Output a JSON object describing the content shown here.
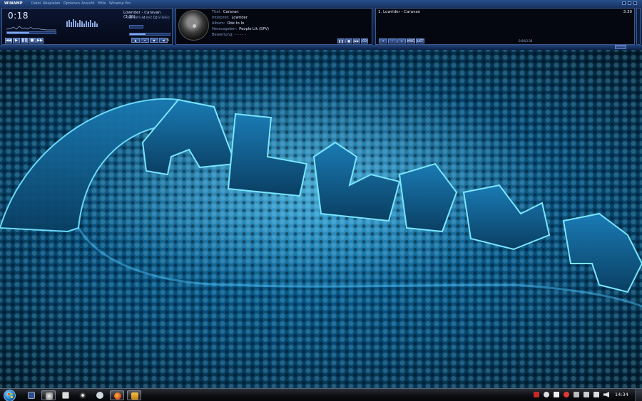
{
  "menubar": {
    "brand": "WINAMP",
    "items": [
      "Datei",
      "Abspielen",
      "Optionen",
      "Ansicht",
      "Hilfe",
      "Winamp Pro"
    ]
  },
  "player": {
    "time": "0:18",
    "track_title": "Lowrider - Caravan (3:30)",
    "bitrate_value": "192",
    "bitrate_unit": "KBPS",
    "samplerate_value": "44",
    "samplerate_unit": "KHZ",
    "mode_value": "CD",
    "mode_unit": "STEREO",
    "volume_fraction": 0.45,
    "transport_buttons": [
      "◀◀",
      "▶",
      "❚❚",
      "■",
      "▶▶"
    ],
    "right_buttons": [
      "▲",
      "≡",
      "◆",
      "◀"
    ]
  },
  "info": {
    "fields": [
      {
        "label": "Titel:",
        "value": "Caravan"
      },
      {
        "label": "Interpret:",
        "value": "Lowrider"
      },
      {
        "label": "Album:",
        "value": "Ode to Io"
      },
      {
        "label": "Herausgeber:",
        "value": "People Lik (SPV)"
      },
      {
        "label": "Bewertung:",
        "value": "· · · · ·"
      }
    ],
    "buttons": [
      "❚❚",
      "■",
      "▶▶",
      "CD"
    ]
  },
  "playlist": {
    "items": [
      {
        "label": "1. Lowrider - Caravan",
        "duration": "3:30"
      }
    ],
    "buttons": [
      "+",
      "−",
      "≡",
      "MISC",
      "LIST"
    ],
    "total_time": "0:00/3:30"
  },
  "taskbar": {
    "clock": "14:34",
    "pinned": [
      "floppy-icon",
      "winamp-icon",
      "folder-icon",
      "media-icon",
      "steam-icon",
      "firefox-icon",
      "winamp-task-icon"
    ]
  },
  "colors": {
    "accent": "#1b8fd2",
    "glow": "#5fd2ff",
    "panel_border": "#3a5a90"
  }
}
